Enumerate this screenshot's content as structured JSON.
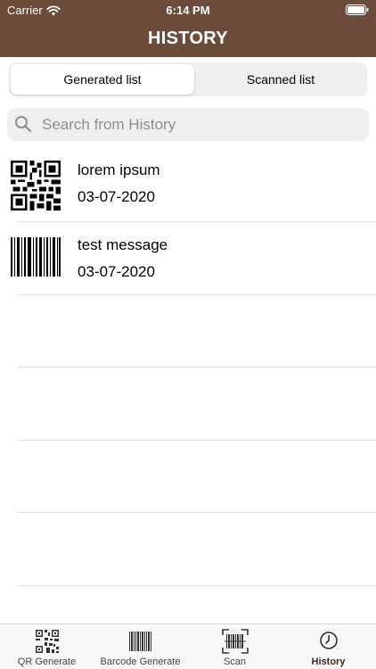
{
  "status_bar": {
    "carrier": "Carrier",
    "time": "6:14 PM"
  },
  "header": {
    "title": "HISTORY"
  },
  "segments": {
    "generated": "Generated list",
    "scanned": "Scanned list"
  },
  "search": {
    "placeholder": "Search from History"
  },
  "history": [
    {
      "title": "lorem ipsum",
      "date": "03-07-2020",
      "icon": "qr-code-icon"
    },
    {
      "title": "test message",
      "date": "03-07-2020",
      "icon": "barcode-icon"
    }
  ],
  "tabs": [
    {
      "label": "QR Generate",
      "icon": "qr-code-icon"
    },
    {
      "label": "Barcode Generate",
      "icon": "barcode-icon"
    },
    {
      "label": "Scan",
      "icon": "scan-icon"
    },
    {
      "label": "History",
      "icon": "clock-icon"
    }
  ],
  "colors": {
    "header": "#6b4c3b",
    "active_tab": "#3a2a20"
  }
}
